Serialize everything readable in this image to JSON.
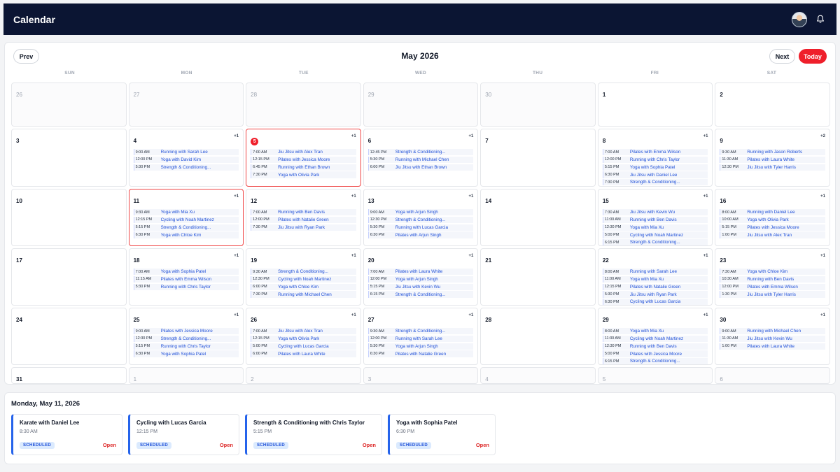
{
  "app": {
    "title": "Calendar"
  },
  "calendar": {
    "month_label": "May 2026",
    "prev_label": "Prev",
    "next_label": "Next",
    "today_label": "Today",
    "weekdays": [
      "SUN",
      "MON",
      "TUE",
      "WED",
      "THU",
      "FRI",
      "SAT"
    ],
    "cells": [
      {
        "day": "26",
        "outside": true,
        "events": []
      },
      {
        "day": "27",
        "outside": true,
        "events": []
      },
      {
        "day": "28",
        "outside": true,
        "events": []
      },
      {
        "day": "29",
        "outside": true,
        "events": []
      },
      {
        "day": "30",
        "outside": true,
        "events": []
      },
      {
        "day": "1",
        "events": []
      },
      {
        "day": "2",
        "events": []
      },
      {
        "day": "3",
        "events": []
      },
      {
        "day": "4",
        "more": "+1",
        "events": [
          {
            "time": "9:00 AM",
            "title": "Running with Sarah Lee"
          },
          {
            "time": "12:00 PM",
            "title": "Yoga with David Kim"
          },
          {
            "time": "5:30 PM",
            "title": "Strength & Conditioning..."
          }
        ]
      },
      {
        "day": "5",
        "today": true,
        "highlight": true,
        "more": "+1",
        "events": [
          {
            "time": "7:00 AM",
            "title": "Jiu Jitsu with Alex Tran"
          },
          {
            "time": "12:15 PM",
            "title": "Pilates with Jessica Moore"
          },
          {
            "time": "6:45 PM",
            "title": "Running with Ethan Brown"
          },
          {
            "time": "7:30 PM",
            "title": "Yoga with Olivia Park"
          }
        ]
      },
      {
        "day": "6",
        "more": "+1",
        "events": [
          {
            "time": "12:45 PM",
            "title": "Strength & Conditioning..."
          },
          {
            "time": "5:30 PM",
            "title": "Running with Michael Chen"
          },
          {
            "time": "6:00 PM",
            "title": "Jiu Jitsu with Ethan Brown"
          }
        ]
      },
      {
        "day": "7",
        "events": []
      },
      {
        "day": "8",
        "more": "+1",
        "events": [
          {
            "time": "7:00 AM",
            "title": "Pilates with Emma Wilson"
          },
          {
            "time": "12:00 PM",
            "title": "Running with Chris Taylor"
          },
          {
            "time": "5:15 PM",
            "title": "Yoga with Sophia Patel"
          },
          {
            "time": "6:30 PM",
            "title": "Jiu Jitsu with Daniel Lee"
          },
          {
            "time": "7:30 PM",
            "title": "Strength & Conditioning..."
          }
        ]
      },
      {
        "day": "9",
        "more": "+2",
        "events": [
          {
            "time": "9:30 AM",
            "title": "Running with Jason Roberts"
          },
          {
            "time": "11:30 AM",
            "title": "Pilates with Laura White"
          },
          {
            "time": "12:30 PM",
            "title": "Jiu Jitsu with Tyler Harris"
          }
        ]
      },
      {
        "day": "10",
        "events": []
      },
      {
        "day": "11",
        "highlight": true,
        "more": "+1",
        "events": [
          {
            "time": "9:30 AM",
            "title": "Yoga with Mia Xu"
          },
          {
            "time": "12:15 PM",
            "title": "Cycling with Noah Martinez"
          },
          {
            "time": "5:15 PM",
            "title": "Strength & Conditioning..."
          },
          {
            "time": "6:30 PM",
            "title": "Yoga with Chloe Kim"
          }
        ]
      },
      {
        "day": "12",
        "more": "+1",
        "events": [
          {
            "time": "7:00 AM",
            "title": "Running with Ben Davis"
          },
          {
            "time": "12:00 PM",
            "title": "Pilates with Natalie Green"
          },
          {
            "time": "7:30 PM",
            "title": "Jiu Jitsu with Ryan Park"
          }
        ]
      },
      {
        "day": "13",
        "more": "+1",
        "events": [
          {
            "time": "9:00 AM",
            "title": "Yoga with Arjun Singh"
          },
          {
            "time": "12:30 PM",
            "title": "Strength & Conditioning..."
          },
          {
            "time": "5:30 PM",
            "title": "Running with Lucas Garcia"
          },
          {
            "time": "6:30 PM",
            "title": "Pilates with Arjun Singh"
          }
        ]
      },
      {
        "day": "14",
        "events": []
      },
      {
        "day": "15",
        "more": "+1",
        "events": [
          {
            "time": "7:30 AM",
            "title": "Jiu Jitsu with Kevin Wu"
          },
          {
            "time": "11:00 AM",
            "title": "Running with Ben Davis"
          },
          {
            "time": "12:30 PM",
            "title": "Yoga with Mia Xu"
          },
          {
            "time": "5:00 PM",
            "title": "Cycling with Noah Martinez"
          },
          {
            "time": "6:15 PM",
            "title": "Strength & Conditioning..."
          }
        ]
      },
      {
        "day": "16",
        "more": "+1",
        "events": [
          {
            "time": "8:00 AM",
            "title": "Running with Daniel Lee"
          },
          {
            "time": "10:00 AM",
            "title": "Yoga with Olivia Park"
          },
          {
            "time": "5:15 PM",
            "title": "Pilates with Jessica Moore"
          },
          {
            "time": "1:00 PM",
            "title": "Jiu Jitsu with Alex Tran"
          }
        ]
      },
      {
        "day": "17",
        "events": []
      },
      {
        "day": "18",
        "more": "+1",
        "events": [
          {
            "time": "7:00 AM",
            "title": "Yoga with Sophia Patel"
          },
          {
            "time": "11:15 AM",
            "title": "Pilates with Emma Wilson"
          },
          {
            "time": "5:30 PM",
            "title": "Running with Chris Taylor"
          }
        ]
      },
      {
        "day": "19",
        "more": "+1",
        "events": [
          {
            "time": "9:30 AM",
            "title": "Strength & Conditioning..."
          },
          {
            "time": "12:30 PM",
            "title": "Cycling with Noah Martinez"
          },
          {
            "time": "6:00 PM",
            "title": "Yoga with Chloe Kim"
          },
          {
            "time": "7:30 PM",
            "title": "Running with Michael Chen"
          }
        ]
      },
      {
        "day": "20",
        "more": "+1",
        "events": [
          {
            "time": "7:00 AM",
            "title": "Pilates with Laura White"
          },
          {
            "time": "12:00 PM",
            "title": "Yoga with Arjun Singh"
          },
          {
            "time": "5:15 PM",
            "title": "Jiu Jitsu with Kevin Wu"
          },
          {
            "time": "6:15 PM",
            "title": "Strength & Conditioning..."
          }
        ]
      },
      {
        "day": "21",
        "events": []
      },
      {
        "day": "22",
        "more": "+1",
        "events": [
          {
            "time": "8:00 AM",
            "title": "Running with Sarah Lee"
          },
          {
            "time": "11:00 AM",
            "title": "Yoga with Mia Xu"
          },
          {
            "time": "12:15 PM",
            "title": "Pilates with Natalie Green"
          },
          {
            "time": "5:30 PM",
            "title": "Jiu Jitsu with Ryan Park"
          },
          {
            "time": "6:30 PM",
            "title": "Cycling with Lucas Garcia"
          }
        ]
      },
      {
        "day": "23",
        "more": "+1",
        "events": [
          {
            "time": "7:30 AM",
            "title": "Yoga with Chloe Kim"
          },
          {
            "time": "10:30 AM",
            "title": "Running with Ben Davis"
          },
          {
            "time": "12:00 PM",
            "title": "Pilates with Emma Wilson"
          },
          {
            "time": "1:30 PM",
            "title": "Jiu Jitsu with Tyler Harris"
          }
        ]
      },
      {
        "day": "24",
        "events": []
      },
      {
        "day": "25",
        "more": "+1",
        "events": [
          {
            "time": "9:00 AM",
            "title": "Pilates with Jessica Moore"
          },
          {
            "time": "12:30 PM",
            "title": "Strength & Conditioning..."
          },
          {
            "time": "5:15 PM",
            "title": "Running with Chris Taylor"
          },
          {
            "time": "6:30 PM",
            "title": "Yoga with Sophia Patel"
          }
        ]
      },
      {
        "day": "26",
        "more": "+1",
        "events": [
          {
            "time": "7:00 AM",
            "title": "Jiu Jitsu with Alex Tran"
          },
          {
            "time": "12:15 PM",
            "title": "Yoga with Olivia Park"
          },
          {
            "time": "5:00 PM",
            "title": "Cycling with Lucas Garcia"
          },
          {
            "time": "6:00 PM",
            "title": "Pilates with Laura White"
          }
        ]
      },
      {
        "day": "27",
        "more": "+1",
        "events": [
          {
            "time": "9:30 AM",
            "title": "Strength & Conditioning..."
          },
          {
            "time": "12:00 PM",
            "title": "Running with Sarah Lee"
          },
          {
            "time": "5:30 PM",
            "title": "Yoga with Arjun Singh"
          },
          {
            "time": "6:30 PM",
            "title": "Pilates with Natalie Green"
          }
        ]
      },
      {
        "day": "28",
        "events": []
      },
      {
        "day": "29",
        "more": "+1",
        "events": [
          {
            "time": "8:00 AM",
            "title": "Yoga with Mia Xu"
          },
          {
            "time": "11:30 AM",
            "title": "Cycling with Noah Martinez"
          },
          {
            "time": "12:30 PM",
            "title": "Running with Ben Davis"
          },
          {
            "time": "5:00 PM",
            "title": "Pilates with Jessica Moore"
          },
          {
            "time": "6:15 PM",
            "title": "Strength & Conditioning..."
          }
        ]
      },
      {
        "day": "30",
        "more": "+1",
        "events": [
          {
            "time": "9:00 AM",
            "title": "Running with Michael Chen"
          },
          {
            "time": "11:30 AM",
            "title": "Jiu Jitsu with Kevin Wu"
          },
          {
            "time": "1:00 PM",
            "title": "Pilates with Laura White"
          }
        ]
      },
      {
        "day": "31",
        "events": []
      },
      {
        "day": "1",
        "outside": true,
        "events": []
      },
      {
        "day": "2",
        "outside": true,
        "events": []
      },
      {
        "day": "3",
        "outside": true,
        "events": []
      },
      {
        "day": "4",
        "outside": true,
        "events": []
      },
      {
        "day": "5",
        "outside": true,
        "events": []
      },
      {
        "day": "6",
        "outside": true,
        "events": []
      }
    ]
  },
  "details": {
    "date_label": "Monday, May 11, 2026",
    "appointments": [
      {
        "title": "Karate with Daniel Lee",
        "time": "8:30 AM",
        "status": "SCHEDULED",
        "action": "Open"
      },
      {
        "title": "Cycling with Lucas Garcia",
        "time": "12:15 PM",
        "status": "SCHEDULED",
        "action": "Open"
      },
      {
        "title": "Strength & Conditioning with Chris Taylor",
        "time": "5:15 PM",
        "status": "SCHEDULED",
        "action": "Open"
      },
      {
        "title": "Yoga with Sophia Patel",
        "time": "6:30 PM",
        "status": "SCHEDULED",
        "action": "Open"
      }
    ]
  },
  "colors": {
    "header_bg": "#0b1533",
    "accent_red": "#ef1f2b",
    "event_blue": "#1d4ed8",
    "card_border_blue": "#2563eb"
  },
  "icons": {
    "avatar": "user-avatar",
    "notifications": "bell-icon"
  }
}
